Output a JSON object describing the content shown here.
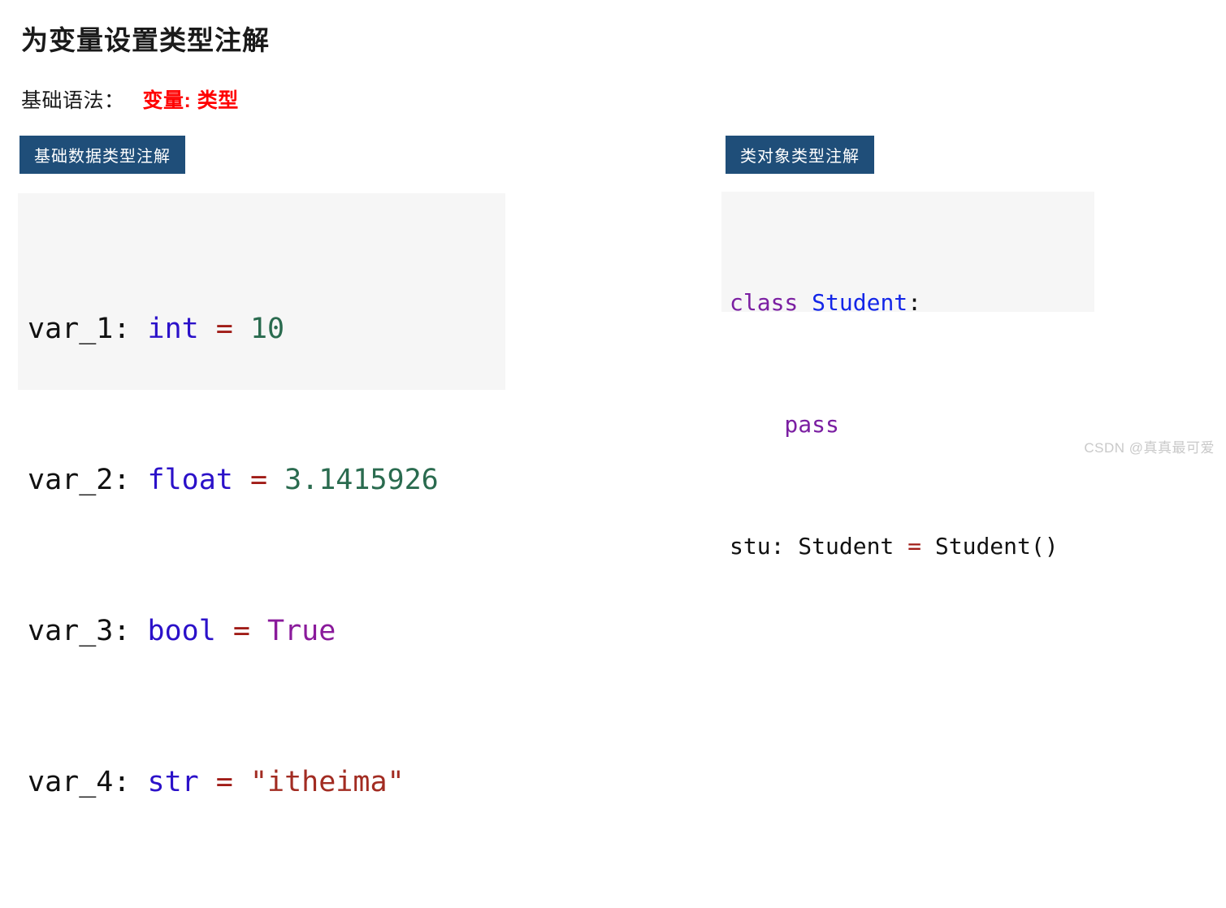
{
  "title": "为变量设置类型注解",
  "syntax": {
    "label": "基础语法：",
    "value": "变量: 类型"
  },
  "badges": {
    "left": "基础数据类型注解",
    "right": "类对象类型注解"
  },
  "colors": {
    "badge_bg": "#1f4e79",
    "accent_red": "#ff0000",
    "code_bg": "#f6f6f6",
    "token_type": "#2b11c9",
    "token_operator": "#a01c17",
    "token_number": "#2a6b4f",
    "token_bool": "#8a1a9b",
    "token_string": "#a22c22",
    "token_keyword": "#7b1fa2",
    "token_class": "#1326e8"
  },
  "code_left": {
    "lines": [
      {
        "name": "var_1",
        "colon": ": ",
        "type": "int",
        "op": " = ",
        "value": "10",
        "value_kind": "num"
      },
      {
        "name": "var_2",
        "colon": ": ",
        "type": "float",
        "op": " = ",
        "value": "3.1415926",
        "value_kind": "num"
      },
      {
        "name": "var_3",
        "colon": ": ",
        "type": "bool",
        "op": " = ",
        "value": "True",
        "value_kind": "bool"
      },
      {
        "name": "var_4",
        "colon": ": ",
        "type": "str",
        "op": " = ",
        "value": "\"itheima\"",
        "value_kind": "str"
      }
    ]
  },
  "code_right": {
    "line1_keyword": "class",
    "line1_space": " ",
    "line1_class": "Student",
    "line1_colon": ":",
    "line2": "    pass",
    "line3_left": "stu: Student ",
    "line3_op": "=",
    "line3_right": " Student()"
  },
  "watermark": "CSDN @真真最可爱"
}
